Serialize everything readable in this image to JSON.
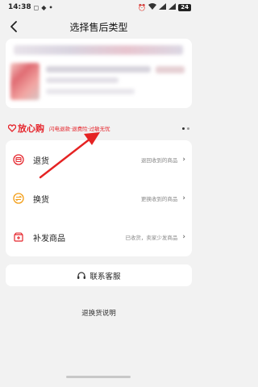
{
  "status_bar": {
    "time": "14:38",
    "battery": "24"
  },
  "nav": {
    "title": "选择售后类型"
  },
  "assurance": {
    "logo": "放心购",
    "subtitle": "闪电退款·退费险·过敏无忧"
  },
  "options": [
    {
      "label": "退货",
      "desc": "退回收到的商品",
      "icon": "return-box-icon"
    },
    {
      "label": "换货",
      "desc": "更换收到的商品",
      "icon": "exchange-icon"
    },
    {
      "label": "补发商品",
      "desc": "已收货，卖家少发商品",
      "icon": "reissue-package-icon"
    }
  ],
  "service": {
    "label": "联系客服"
  },
  "footer": {
    "explain": "退换货说明"
  },
  "colors": {
    "accent": "#e5242b",
    "exchange": "#f39c12",
    "annotation_arrow": "#e52323"
  }
}
